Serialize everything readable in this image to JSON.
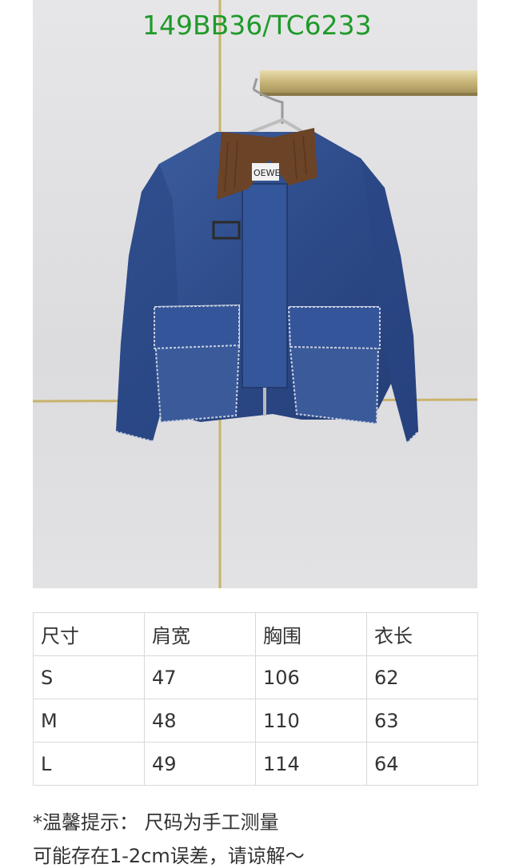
{
  "product": {
    "code": "149BB36/TC6233",
    "image_alt": "blue denim jacket with brown corduroy collar on hanger",
    "collar_label": "OEWE"
  },
  "size_table": {
    "headers": [
      "尺寸",
      "肩宽",
      "胸围",
      "衣长"
    ],
    "rows": [
      [
        "S",
        "47",
        "106",
        "62"
      ],
      [
        "M",
        "48",
        "110",
        "63"
      ],
      [
        "L",
        "49",
        "114",
        "64"
      ]
    ]
  },
  "notes": {
    "line1": "*温馨提示：  尺码为手工测量",
    "line2": "可能存在1-2cm误差，请谅解～"
  },
  "colors": {
    "code_green": "#1f9a2a",
    "denim": "#2f4f8f",
    "collar": "#6b4326"
  }
}
